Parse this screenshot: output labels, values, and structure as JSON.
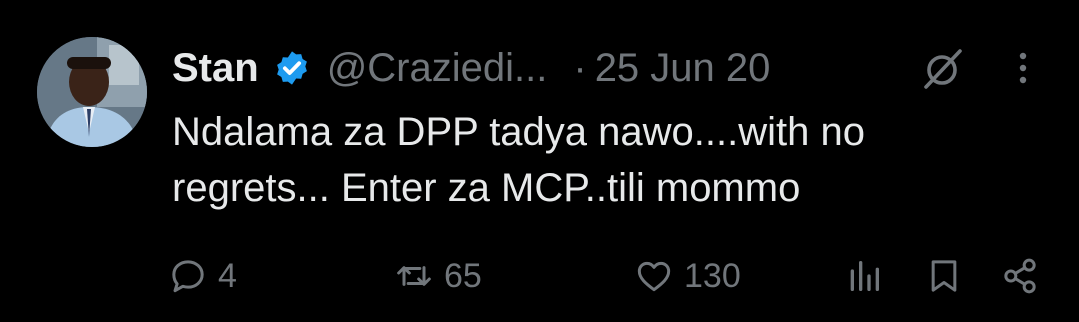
{
  "author": {
    "name": "Stan",
    "handle": "@Craziedi...",
    "separator": "·",
    "date": "25 Jun 20",
    "verified_badge": "verified-check-icon"
  },
  "tweet": {
    "line1": "Ndalama za DPP tadya nawo....with no",
    "line2": "regrets... Enter za MCP..tili mommo"
  },
  "actions": {
    "replies": "4",
    "reposts": "65",
    "likes": "130"
  },
  "icons": {
    "top_right": [
      "grok-icon",
      "more-options-icon"
    ],
    "action_bar": [
      "reply-icon",
      "repost-icon",
      "like-icon",
      "views-icon",
      "bookmark-icon",
      "share-icon"
    ]
  },
  "colors": {
    "background": "#000000",
    "text_primary": "#e7e9ea",
    "text_secondary": "#71767b",
    "verified_blue": "#1d9bf0"
  }
}
